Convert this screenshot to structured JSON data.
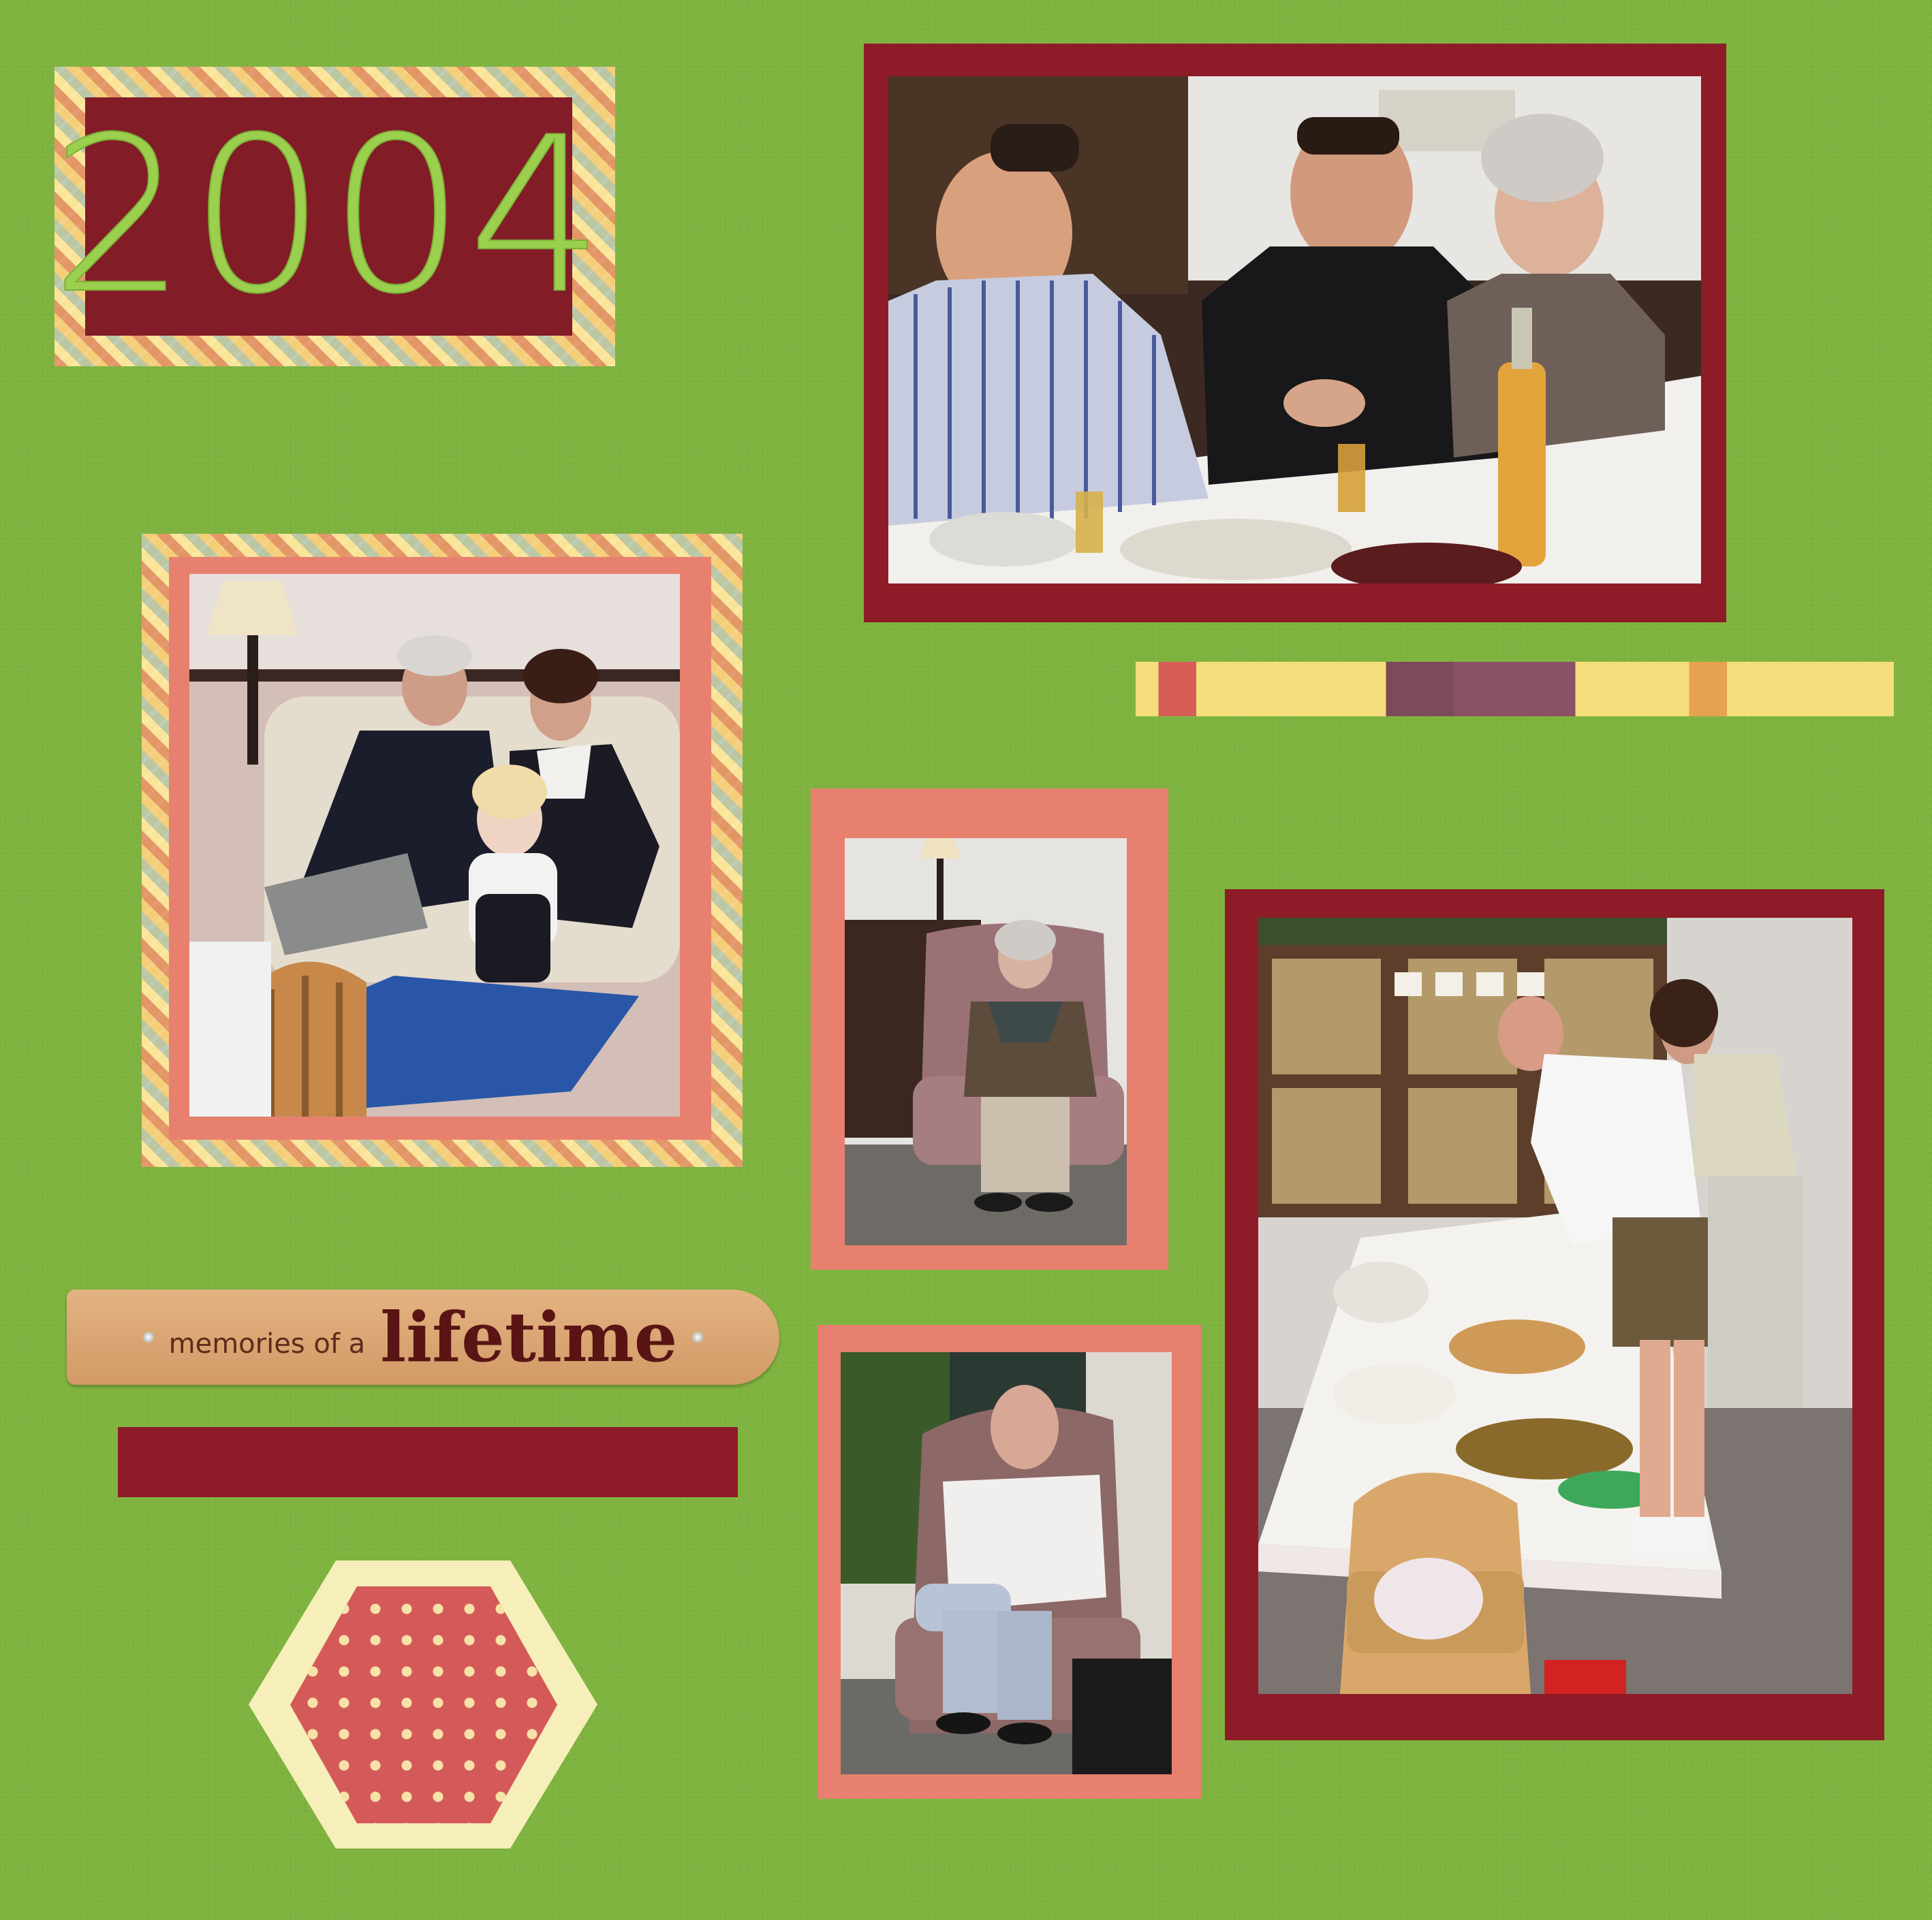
{
  "title_block": {
    "year": "2004"
  },
  "sentiment_tag": {
    "prefix": "memories of a",
    "word": "lifetime"
  },
  "colors": {
    "cardstock_green": "#7fb33f",
    "mat_burgundy": "#8d1c28",
    "mat_salmon": "#e88070",
    "title_green": "#9ad04e",
    "hexagon_red": "#d45a5a",
    "hexagon_cream": "#f6efb9"
  },
  "photos": [
    {
      "name": "family-dinner-table-photo",
      "subject": "three adults eating dessert at a dining table"
    },
    {
      "name": "grandparents-with-toddler-photo",
      "subject": "couple on sofa with a toddler holding a doll"
    },
    {
      "name": "grandmother-in-armchair-photo",
      "subject": "elderly woman seated in pink armchair"
    },
    {
      "name": "buffet-table-photo",
      "subject": "people serving food at a long buffet table"
    },
    {
      "name": "grandfather-in-armchair-photo",
      "subject": "elderly man seated in pink wingback chair"
    }
  ]
}
